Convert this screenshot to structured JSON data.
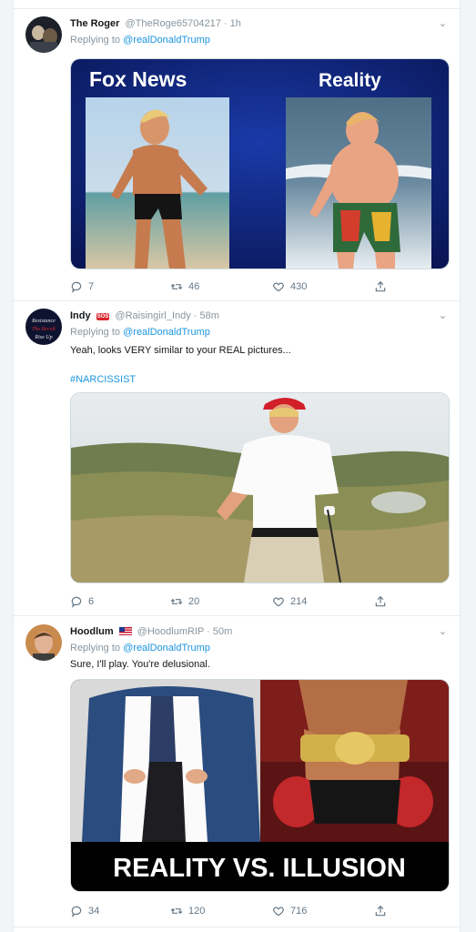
{
  "tweets": [
    {
      "name": "The Roger",
      "handle": "@TheRoge65704217 · 1h",
      "replying_prefix": "Replying to",
      "replying_to": "@realDonaldTrump",
      "text": "",
      "media": {
        "left_label": "Fox News",
        "right_label": "Reality"
      },
      "stats": {
        "replies": "7",
        "retweets": "46",
        "likes": "430"
      }
    },
    {
      "name": "Indy",
      "badge": "SOS",
      "handle": "@Raisingirl_Indy · 58m",
      "replying_prefix": "Replying to",
      "replying_to": "@realDonaldTrump",
      "text": "Yeah, looks VERY similar to your REAL pictures...",
      "hashtag": "#NARCISSIST",
      "stats": {
        "replies": "6",
        "retweets": "20",
        "likes": "214"
      }
    },
    {
      "name": "Hoodlum",
      "handle": "@HoodlumRIP · 50m",
      "replying_prefix": "Replying to",
      "replying_to": "@realDonaldTrump",
      "text": "Sure, I'll play. You're delusional.",
      "media": {
        "caption": "REALITY VS. ILLUSION"
      },
      "stats": {
        "replies": "34",
        "retweets": "120",
        "likes": "716"
      }
    }
  ],
  "icons": [
    "reply-icon",
    "retweet-icon",
    "like-icon",
    "share-icon",
    "caret-down-icon"
  ],
  "colors": {
    "link": "#1b95e0",
    "muted": "#8a959d",
    "flag_badge": "#d9262b",
    "fox_bg": "#0b1a63"
  }
}
